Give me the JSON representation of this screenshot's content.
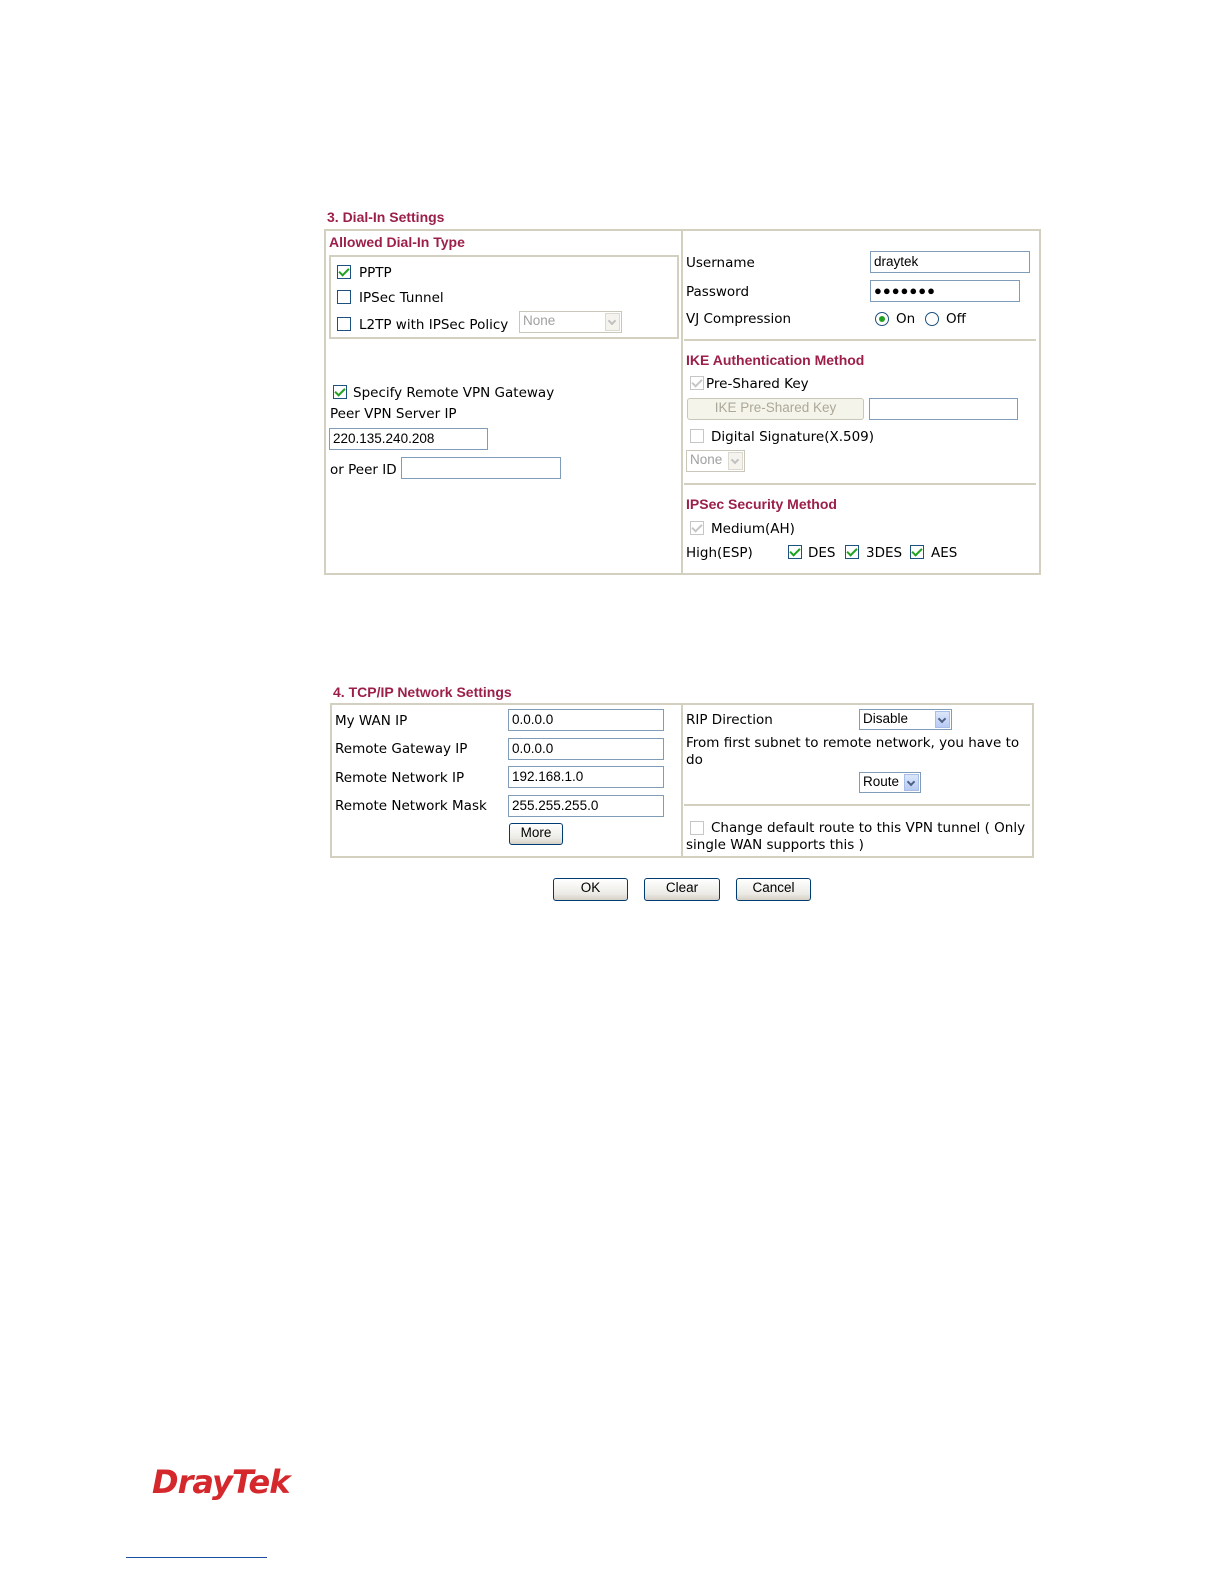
{
  "dial_in": {
    "section_title": "3. Dial-In Settings",
    "allowed_type_title": "Allowed Dial-In Type",
    "pptp_label": "PPTP",
    "ipsec_tunnel_label": "IPSec Tunnel",
    "l2tp_label": "L2TP with IPSec Policy",
    "l2tp_policy_value": "None",
    "specify_gateway_label": "Specify Remote VPN Gateway",
    "peer_server_ip_label": "Peer VPN Server IP",
    "peer_server_ip_value": "220.135.240.208",
    "peer_id_label": "or Peer ID",
    "peer_id_value": "",
    "username_label": "Username",
    "username_value": "draytek",
    "password_label": "Password",
    "password_value": "●●●●●●●",
    "vj_label": "VJ Compression",
    "vj_on_label": "On",
    "vj_off_label": "Off",
    "ike_title": "IKE Authentication Method",
    "pre_shared_label": "Pre-Shared Key",
    "ike_psk_button": "IKE Pre-Shared Key",
    "ike_psk_value": "",
    "digital_sig_label": "Digital Signature(X.509)",
    "digital_sig_value": "None",
    "ipsec_title": "IPSec Security Method",
    "medium_label": "Medium(AH)",
    "high_label": "High(ESP)",
    "des_label": "DES",
    "tdes_label": "3DES",
    "aes_label": "AES"
  },
  "tcpip": {
    "section_title": "4. TCP/IP Network Settings",
    "my_wan_ip_label": "My WAN IP",
    "my_wan_ip_value": "0.0.0.0",
    "remote_gw_label": "Remote Gateway IP",
    "remote_gw_value": "0.0.0.0",
    "remote_net_ip_label": "Remote Network IP",
    "remote_net_ip_value": "192.168.1.0",
    "remote_mask_label": "Remote Network Mask",
    "remote_mask_value": "255.255.255.0",
    "more_button": "More",
    "rip_label": "RIP Direction",
    "rip_value": "Disable",
    "subnet_text": "From first subnet to remote network, you have to do",
    "subnet_value": "Route",
    "default_route_label": "Change default route to this VPN tunnel ( Only single WAN supports this )"
  },
  "buttons": {
    "ok": "OK",
    "clear": "Clear",
    "cancel": "Cancel"
  },
  "footer": {
    "logo_text": "DrayTek"
  },
  "colors": {
    "accent": "#9c1f4a",
    "border": "#d4d0c0",
    "check": "#21a121",
    "logo": "#d4282d"
  }
}
